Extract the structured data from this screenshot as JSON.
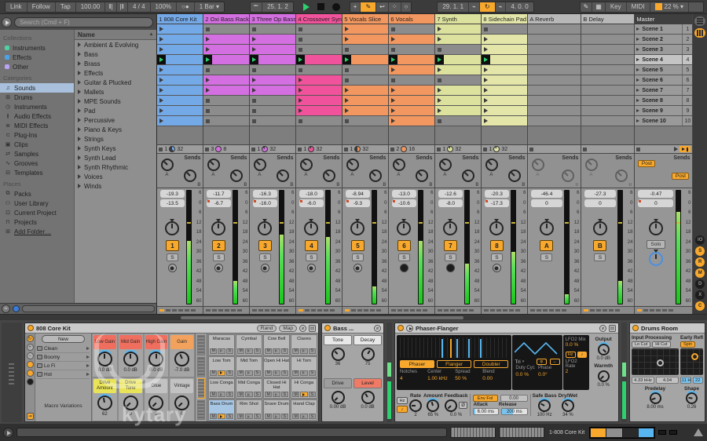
{
  "toolbar": {
    "link": "Link",
    "follow": "Follow",
    "tap": "Tap",
    "tempo": "100.00",
    "time_sig": "4 / 4",
    "quantize": "100%",
    "metronome": "○●",
    "groove_menu": "1 Bar",
    "arrange_pos": "25. 1. 2",
    "loop_start": "29. 1. 1",
    "loop_length": "4. 0. 0",
    "overdub": "+",
    "key": "Key",
    "midi": "MIDI",
    "cpu": "22 %"
  },
  "browser": {
    "search_placeholder": "Search (Cmd + F)",
    "collections_label": "Collections",
    "collections": [
      {
        "label": "Instruments",
        "color": "#4fd1a1"
      },
      {
        "label": "Effects",
        "color": "#4aa3e8"
      },
      {
        "label": "Other",
        "color": "#b9a3f5"
      }
    ],
    "categories_label": "Categories",
    "categories": [
      {
        "label": "Sounds",
        "icon": "♫",
        "sel": "1"
      },
      {
        "label": "Drums",
        "icon": "⊞",
        "sel": "0"
      },
      {
        "label": "Instruments",
        "icon": "◷",
        "sel": "0"
      },
      {
        "label": "Audio Effects",
        "icon": "≬",
        "sel": "0"
      },
      {
        "label": "MIDI Effects",
        "icon": "≣",
        "sel": "0"
      },
      {
        "label": "Plug-Ins",
        "icon": "⊂",
        "sel": "0"
      },
      {
        "label": "Clips",
        "icon": "▣",
        "sel": "0"
      },
      {
        "label": "Samples",
        "icon": "⇄",
        "sel": "0"
      },
      {
        "label": "Grooves",
        "icon": "∿",
        "sel": "0"
      },
      {
        "label": "Templates",
        "icon": "⊟",
        "sel": "0"
      }
    ],
    "places_label": "Places",
    "places": [
      {
        "label": "Packs",
        "icon": "⧉",
        "ul": "0"
      },
      {
        "label": "User Library",
        "icon": "⚇",
        "ul": "0"
      },
      {
        "label": "Current Project",
        "icon": "⊡",
        "ul": "0"
      },
      {
        "label": "Projects",
        "icon": "⊓",
        "ul": "0"
      },
      {
        "label": "Add Folder…",
        "icon": "⊞",
        "ul": "1"
      }
    ],
    "name_header": "Name",
    "items": [
      "Ambient & Evolving",
      "Bass",
      "Brass",
      "Effects",
      "Guitar & Plucked",
      "Mallets",
      "MPE Sounds",
      "Pad",
      "Percussive",
      "Piano & Keys",
      "Strings",
      "Synth Keys",
      "Synth Lead",
      "Synth Rhythmic",
      "Voices",
      "Winds"
    ]
  },
  "session": {
    "sends_label": "Sends",
    "send_a": "A",
    "send_b": "B",
    "solo_s": "S",
    "meter_scale": [
      6,
      0,
      6,
      12,
      18,
      24,
      30,
      36,
      42,
      48,
      54,
      60
    ],
    "tracks": [
      {
        "name": "1 808 Core Kit",
        "color": "#74a9e8",
        "slots": [
          "c",
          "c",
          "c",
          "p",
          "c",
          "c",
          "c",
          "c",
          "c",
          "c"
        ],
        "pos": "1",
        "len": "32",
        "pie": "40%",
        "peak": "-19.3",
        "vol": "-13.5",
        "auto": "0",
        "num": "1",
        "meter": "55%",
        "mon": "dot",
        "xf": "1"
      },
      {
        "name": "2 Oxi Bass Rack",
        "color": "#d36fe0",
        "slots": [
          "s",
          "c",
          "c",
          "p",
          "s",
          "c",
          "c",
          "s",
          "s",
          "s"
        ],
        "pos": "3",
        "len": "8",
        "pie": "100%",
        "peak": "-11.7",
        "vol": "-6.7",
        "auto": "1",
        "num": "2",
        "meter": "20%",
        "mon": "dot",
        "xf": "0"
      },
      {
        "name": "3 Three Op Bass",
        "color": "#d36fe0",
        "slots": [
          "s",
          "c",
          "c",
          "p",
          "s",
          "c",
          "c",
          "s",
          "s",
          "s"
        ],
        "pos": "1",
        "len": "32",
        "pie": "85%",
        "peak": "-16.3",
        "vol": "-16.0",
        "auto": "1",
        "num": "3",
        "meter": "60%",
        "mon": "dot",
        "xf": "0"
      },
      {
        "name": "4 Crossover Syn",
        "color": "#f0539b",
        "slots": [
          "s",
          "s",
          "s",
          "p",
          "s",
          "c",
          "c",
          "c",
          "c",
          "s"
        ],
        "pos": "1",
        "len": "32",
        "pie": "90%",
        "peak": "-18.0",
        "vol": "-6.0",
        "auto": "1",
        "num": "4",
        "meter": "58%",
        "mon": "dot",
        "xf": "1"
      },
      {
        "name": "5 Vocals Slice",
        "color": "#f29760",
        "slots": [
          "c",
          "c",
          "s",
          "p",
          "s",
          "s",
          "c",
          "c",
          "c",
          "s"
        ],
        "pos": "1",
        "len": "32",
        "pie": "50%",
        "peak": "-8.94",
        "vol": "-9.3",
        "auto": "1",
        "num": "5",
        "meter": "15%",
        "mon": "dot",
        "xf": "1"
      },
      {
        "name": "6 Vocals",
        "color": "#f29760",
        "slots": [
          "s",
          "c",
          "s",
          "p",
          "c",
          "s",
          "c",
          "c",
          "c",
          "c"
        ],
        "pos": "2",
        "len": "16",
        "pie": "100%",
        "peak": "-13.0",
        "vol": "-10.6",
        "auto": "1",
        "num": "6",
        "meter": "55%",
        "mon": "filled",
        "xf": "0"
      },
      {
        "name": "7 Synth",
        "color": "#dce29d",
        "slots": [
          "c",
          "c",
          "s",
          "p",
          "c",
          "s",
          "c",
          "c",
          "c",
          "s"
        ],
        "pos": "1",
        "len": "32",
        "pie": "90%",
        "peak": "-12.6",
        "vol": "-8.0",
        "auto": "0",
        "num": "7",
        "meter": "35%",
        "mon": "filled",
        "xf": "0"
      },
      {
        "name": "8 Sidechain Pad",
        "color": "#e3e6a8",
        "slots": [
          "s",
          "c",
          "c",
          "p",
          "c",
          "c",
          "c",
          "c",
          "c",
          "c"
        ],
        "pos": "1",
        "len": "32",
        "pie": "90%",
        "peak": "-20.3",
        "vol": "-17.3",
        "auto": "1",
        "num": "8",
        "meter": "45%",
        "mon": "dot",
        "xf": "0"
      }
    ],
    "return_rows": [
      "e",
      "e",
      "e",
      "e",
      "e",
      "e",
      "e",
      "e",
      "e",
      "e"
    ],
    "returns": [
      {
        "name": "A Reverb",
        "color": "#b8b8b8",
        "peak": "-46.4",
        "vol": "0",
        "num": "A",
        "meter": "8%",
        "xf": "0"
      },
      {
        "name": "B Delay",
        "color": "#b8b8b8",
        "peak": "-27.3",
        "vol": "0",
        "num": "B",
        "meter": "20%",
        "xf": "1"
      }
    ],
    "master": {
      "name": "Master",
      "peak": "-0.47",
      "vol": "0",
      "meter": "80%",
      "solo_label": "Solo",
      "post_a": "Post",
      "post_b": "Post",
      "xf": "1",
      "scenes": [
        {
          "label": "Scene 1",
          "num": "1",
          "hl": "0"
        },
        {
          "label": "Scene 2",
          "num": "2",
          "hl": "0"
        },
        {
          "label": "Scene 3",
          "num": "3",
          "hl": "0"
        },
        {
          "label": "Scene 4",
          "num": "4",
          "hl": "1"
        },
        {
          "label": "Scene 5",
          "num": "5",
          "hl": "0"
        },
        {
          "label": "Scene 6",
          "num": "6",
          "hl": "0"
        },
        {
          "label": "Scene 7",
          "num": "7",
          "hl": "0"
        },
        {
          "label": "Scene 8",
          "num": "8",
          "hl": "0"
        },
        {
          "label": "Scene 9",
          "num": "9",
          "hl": "0"
        },
        {
          "label": "Scene 10",
          "num": "10",
          "hl": "0"
        }
      ]
    }
  },
  "right_strip": {
    "toggles": [
      {
        "label": "IO",
        "on": "0"
      },
      {
        "label": "S",
        "on": "1"
      },
      {
        "label": "R",
        "on": "1"
      },
      {
        "label": "M",
        "on": "1"
      },
      {
        "label": "D",
        "on": "0"
      },
      {
        "label": "X",
        "on": "0"
      },
      {
        "label": "C",
        "on": "1"
      }
    ]
  },
  "devices": {
    "drumrack": {
      "title": "808 Core Kit",
      "rand": "Rand",
      "map": "Map",
      "new_label": "New",
      "variations": [
        "Clean",
        "Boomy",
        "Lo Fi",
        "Hot"
      ],
      "variations_label": "Macro Variations",
      "macros": [
        {
          "name": "Low Gain",
          "value": "0.0 dB",
          "hdr": "#ef6e5e",
          "rot": "0deg",
          "arc": "1"
        },
        {
          "name": "Mid Gain",
          "value": "0.0 dB",
          "hdr": "#ef6e5e",
          "rot": "0deg",
          "arc": "1"
        },
        {
          "name": "High Gain",
          "value": "0.0 dB",
          "hdr": "#ef6e5e",
          "rot": "0deg",
          "arc": "1"
        },
        {
          "name": "Gain",
          "value": "-7.0 dB",
          "hdr": "#f2a25c",
          "rot": "-25deg",
          "arc": "0"
        },
        {
          "name": "Drive Amount",
          "value": "62",
          "hdr": "#e9e457",
          "rot": "-10deg",
          "arc": "1"
        },
        {
          "name": "Drive Tone",
          "value": "0",
          "hdr": "#e9e457",
          "rot": "-135deg",
          "arc": "0"
        },
        {
          "name": "Glue",
          "value": "0",
          "hdr": "#c2c2c2",
          "rot": "-135deg",
          "arc": "0"
        },
        {
          "name": "Vintage",
          "value": "0",
          "hdr": "#c2c2c2",
          "rot": "-135deg",
          "arc": "0"
        }
      ],
      "pad_m": "M",
      "pad_s": "S",
      "pads": [
        {
          "name": "Maracas",
          "play": "0",
          "sel": "0"
        },
        {
          "name": "Cymbal",
          "play": "0",
          "sel": "0"
        },
        {
          "name": "Cow Bell",
          "play": "0",
          "sel": "0"
        },
        {
          "name": "Claves",
          "play": "0",
          "sel": "0"
        },
        {
          "name": "Low Tom",
          "play": "1",
          "sel": "0"
        },
        {
          "name": "Mid Tom",
          "play": "0",
          "sel": "0"
        },
        {
          "name": "Open Hi Hat",
          "play": "0",
          "sel": "0"
        },
        {
          "name": "Hi Tom",
          "play": "0",
          "sel": "0"
        },
        {
          "name": "Low Conga",
          "play": "0",
          "sel": "0"
        },
        {
          "name": "Mid Conga",
          "play": "0",
          "sel": "0"
        },
        {
          "name": "Closed Hi Hat",
          "play": "0",
          "sel": "0"
        },
        {
          "name": "Hi Conga",
          "play": "1",
          "sel": "0"
        },
        {
          "name": "Bass Drum",
          "play": "1",
          "sel": "1"
        },
        {
          "name": "Rim Shot",
          "play": "0",
          "sel": "0"
        },
        {
          "name": "Snare Drum",
          "play": "0",
          "sel": "0"
        },
        {
          "name": "Hand Clap",
          "play": "0",
          "sel": "0"
        }
      ]
    },
    "bass": {
      "title": "Bass ...",
      "params": [
        {
          "name": "Tone",
          "value": "36",
          "style": "",
          "rot": "-45deg"
        },
        {
          "name": "Decay",
          "value": "75",
          "style": "",
          "rot": "30deg"
        },
        {
          "name": "Drive",
          "value": "0.00 dB",
          "style": "gray",
          "rot": "-135deg"
        },
        {
          "name": "Level",
          "value": "0.0 dB",
          "style": "red",
          "rot": "-30deg"
        }
      ]
    },
    "phaser": {
      "title": "Phaser-Flanger",
      "modes": [
        {
          "label": "Phaser",
          "on": "1"
        },
        {
          "label": "Flanger",
          "on": "0"
        },
        {
          "label": "Doubler",
          "on": "0"
        }
      ],
      "params": [
        {
          "name": "Notches",
          "value": "4"
        },
        {
          "name": "Center",
          "value": "1.00 kHz"
        },
        {
          "name": "Spread",
          "value": "50 %"
        },
        {
          "name": "Blend",
          "value": "0.00"
        }
      ],
      "wave_label": "Tri",
      "duty_name": "Duty Cyc",
      "duty": "0.0 %",
      "phase_name": "Phase",
      "phase": "0.0°",
      "lfo2_mix_name": "LFO2 Mix",
      "lfo2_mix": "0.0 %",
      "hz": "Hz",
      "note": "♪",
      "lfo2_rate_name": "LFO2 Rate",
      "lfo2_rate": "2",
      "output_name": "Output",
      "output": "0.0 dB",
      "warmth_name": "Warmth",
      "warmth": "0.0 %",
      "rate_name": "Rate",
      "rate": "2",
      "amount_name": "Amount",
      "amount": "65 %",
      "feedback_name": "Feedback",
      "feedback": "0.0 %",
      "inv": "Ø",
      "env_label": "Env Fol",
      "env_val": "0.00",
      "attack_name": "Attack",
      "attack": "6.00 ms",
      "release_name": "Release",
      "release": "200 ms",
      "safe_name": "Safe Bass",
      "safe": "100 Hz",
      "drywet_name": "Dry/Wet",
      "drywet": "34 %"
    },
    "reverb": {
      "title": "Drums Room",
      "input_label": "Input Processing",
      "lo_cut": "Lo Cut",
      "hi_cut": "Hi Cut",
      "freq": "4.33 kHz",
      "q": "4.04",
      "er_label": "Early Reflectio",
      "spin": "Spin",
      "spin_hz": "0.11 Hz",
      "spin_amt": "22",
      "predelay_name": "Predelay",
      "predelay": "8.00 ms",
      "shape_name": "Shape",
      "shape": "0.26"
    }
  },
  "status_bar": {
    "chain": "1-808 Core Kit"
  },
  "watermark": "kytary"
}
